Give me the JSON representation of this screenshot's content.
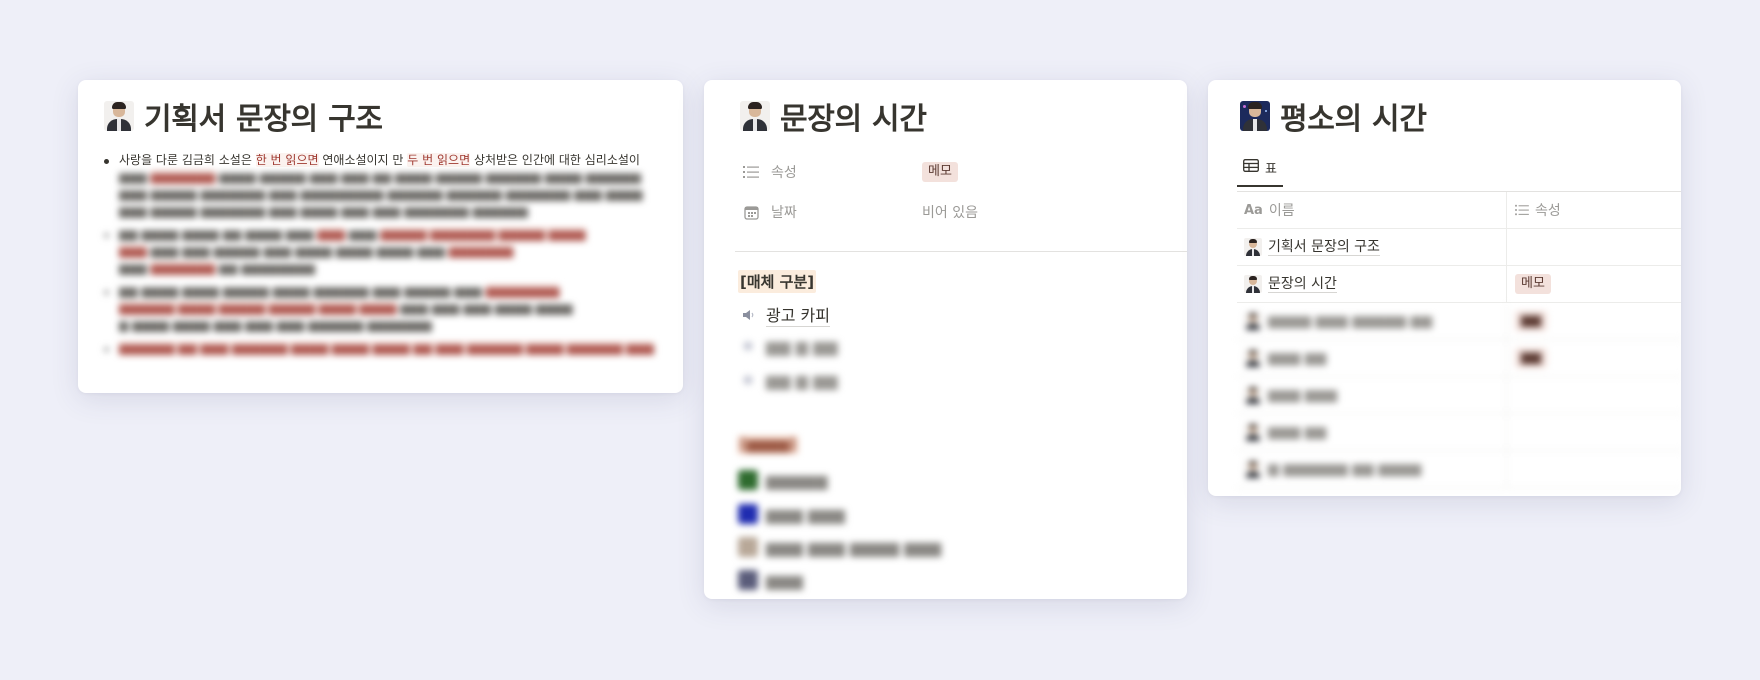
{
  "cards": [
    {
      "title": "기획서 문장의 구조",
      "icon": "person-avatar-icon",
      "bullet1": {
        "seg1": "사랑을 다룬 김금희 소설은 ",
        "hl1": "한 번 읽으면",
        "seg2": " 연애소설이지 만 ",
        "hl2": "두 번 읽으면",
        "seg3": " 상처받은 인간에 대한 심리소설이"
      }
    },
    {
      "title": "문장의 시간",
      "icon": "person-avatar-icon",
      "properties": [
        {
          "label": "속성",
          "icon": "list-icon",
          "value": "메모",
          "value_style": "tag"
        },
        {
          "label": "날짜",
          "icon": "calendar-icon",
          "value": "비어 있음",
          "value_style": "empty"
        }
      ],
      "section_heading": "[매체 구분]",
      "items": [
        {
          "label": "광고 카피",
          "icon": "speaker-icon"
        }
      ]
    },
    {
      "title": "평소의 시간",
      "icon": "space-avatar-icon",
      "tab": {
        "label": "표",
        "icon": "table-icon"
      },
      "table": {
        "columns": [
          {
            "label": "이름",
            "prefix": "Aa",
            "icon": "text-icon"
          },
          {
            "label": "속성",
            "icon": "list-icon"
          }
        ],
        "rows": [
          {
            "name": "기획서 문장의 구조",
            "prop": ""
          },
          {
            "name": "문장의 시간",
            "prop": "메모"
          }
        ]
      }
    }
  ],
  "colors": {
    "background": "#eeeff8",
    "tag_bg": "#f3e1dc",
    "highlight_text": "#9f3930",
    "section_heading_bg": "#fbecdd"
  }
}
